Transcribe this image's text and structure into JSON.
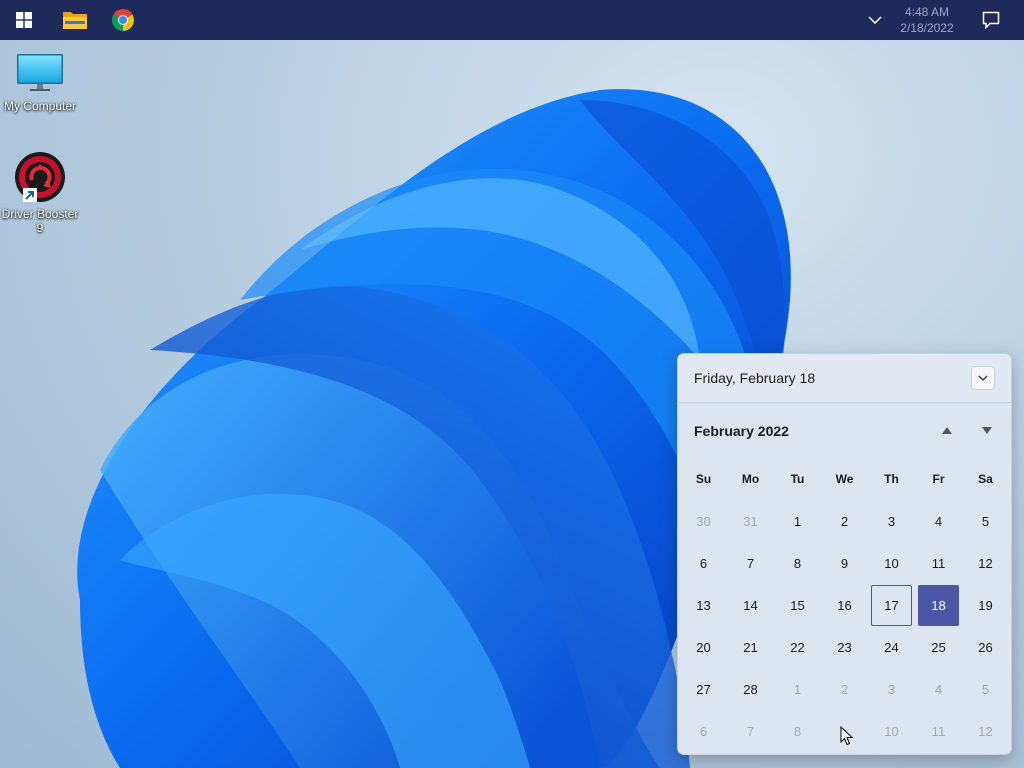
{
  "taskbar": {
    "apps": [
      {
        "name": "start",
        "icon": "windows-logo-icon"
      },
      {
        "name": "file-explorer",
        "icon": "folder-icon"
      },
      {
        "name": "chrome",
        "icon": "chrome-icon"
      }
    ],
    "clock": {
      "time": "4:48 AM",
      "date": "2/18/2022"
    },
    "colors": {
      "background": "#1e2a5a",
      "clock_text": "#9aa5c9"
    }
  },
  "desktop": {
    "icons": [
      {
        "label": "My Computer",
        "icon": "monitor-icon"
      },
      {
        "label": "Driver Booster 9",
        "icon": "driver-booster-icon",
        "shortcut": true
      }
    ]
  },
  "calendar": {
    "header_date": "Friday, February 18",
    "month_label": "February 2022",
    "weekdays": [
      "Su",
      "Mo",
      "Tu",
      "We",
      "Th",
      "Fr",
      "Sa"
    ],
    "weeks": [
      [
        {
          "d": "30",
          "other": true
        },
        {
          "d": "31",
          "other": true
        },
        {
          "d": "1"
        },
        {
          "d": "2"
        },
        {
          "d": "3"
        },
        {
          "d": "4"
        },
        {
          "d": "5"
        }
      ],
      [
        {
          "d": "6"
        },
        {
          "d": "7"
        },
        {
          "d": "8"
        },
        {
          "d": "9"
        },
        {
          "d": "10"
        },
        {
          "d": "11"
        },
        {
          "d": "12"
        }
      ],
      [
        {
          "d": "13"
        },
        {
          "d": "14"
        },
        {
          "d": "15"
        },
        {
          "d": "16"
        },
        {
          "d": "17",
          "hover": true
        },
        {
          "d": "18",
          "today": true
        },
        {
          "d": "19"
        }
      ],
      [
        {
          "d": "20"
        },
        {
          "d": "21"
        },
        {
          "d": "22"
        },
        {
          "d": "23"
        },
        {
          "d": "24"
        },
        {
          "d": "25"
        },
        {
          "d": "26"
        }
      ],
      [
        {
          "d": "27"
        },
        {
          "d": "28"
        },
        {
          "d": "1",
          "other": true
        },
        {
          "d": "2",
          "other": true
        },
        {
          "d": "3",
          "other": true
        },
        {
          "d": "4",
          "other": true
        },
        {
          "d": "5",
          "other": true
        }
      ],
      [
        {
          "d": "6",
          "other": true
        },
        {
          "d": "7",
          "other": true
        },
        {
          "d": "8",
          "other": true
        },
        {
          "d": "",
          "other": true
        },
        {
          "d": "10",
          "other": true
        },
        {
          "d": "11",
          "other": true
        },
        {
          "d": "12",
          "other": true
        }
      ]
    ],
    "colors": {
      "today": "#4a57a6",
      "panel": "#dde5f1",
      "muted_text": "#a3a9b3"
    }
  }
}
